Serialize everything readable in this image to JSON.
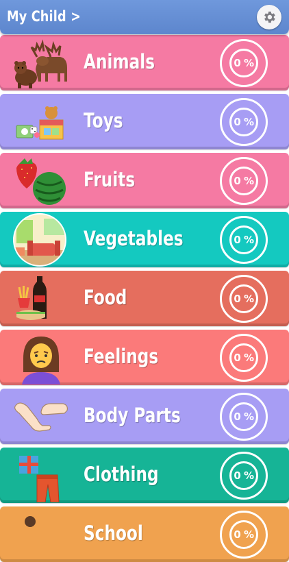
{
  "header": {
    "title": "My Child >",
    "settings_icon": "gear-icon"
  },
  "categories": [
    {
      "label": "Animals",
      "percent": "0 %",
      "color": "#f57aa3",
      "icon": "moose-bear-icon"
    },
    {
      "label": "Toys",
      "percent": "0 %",
      "color": "#a79df4",
      "icon": "toy-blocks-icon"
    },
    {
      "label": "Fruits",
      "percent": "0 %",
      "color": "#f57aa3",
      "icon": "strawberry-watermelon-icon"
    },
    {
      "label": "Vegetables",
      "percent": "0 %",
      "color": "#14c9c0",
      "icon": "room-scene-icon"
    },
    {
      "label": "Food",
      "percent": "0 %",
      "color": "#e56e5e",
      "icon": "fries-soda-sandwich-icon"
    },
    {
      "label": "Feelings",
      "percent": "0 %",
      "color": "#fb7a7a",
      "icon": "worried-girl-icon"
    },
    {
      "label": "Body Parts",
      "percent": "0 %",
      "color": "#a79df4",
      "icon": "arm-foot-icon"
    },
    {
      "label": "Clothing",
      "percent": "0 %",
      "color": "#16b496",
      "icon": "gift-pants-icon"
    },
    {
      "label": "School",
      "percent": "0 %",
      "color": "#f0a24f",
      "icon": "school-icon"
    }
  ]
}
